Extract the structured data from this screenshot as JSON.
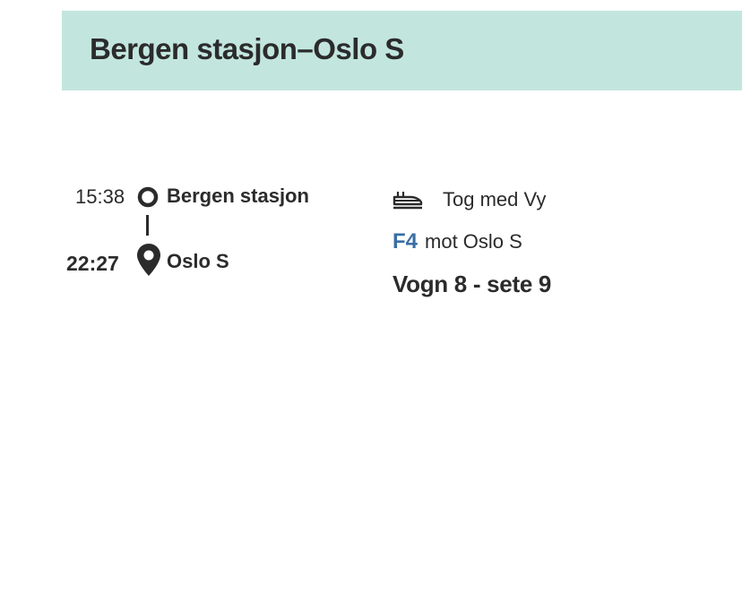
{
  "header": {
    "title": "Bergen stasjon–Oslo S",
    "background_color": "#c2e6de"
  },
  "journey": {
    "departure": {
      "time": "15:38",
      "station": "Bergen stasjon",
      "icon": "origin-circle-icon"
    },
    "arrival": {
      "time": "22:27",
      "station": "Oslo S",
      "icon": "location-pin-icon"
    }
  },
  "service": {
    "mode_icon": "train-icon",
    "operator_text": "Tog med Vy",
    "line_code": "F4",
    "line_color": "#3a6ea5",
    "direction_text": "mot Oslo S",
    "seat_text": "Vogn 8 - sete 9"
  }
}
